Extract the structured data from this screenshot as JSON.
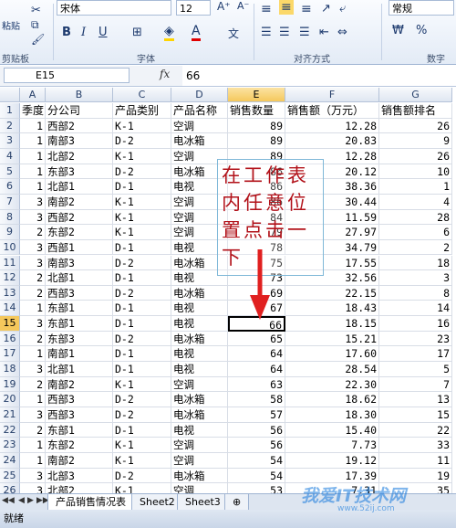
{
  "ribbon": {
    "font_name": "宋体",
    "font_size": "12",
    "number_format": "常规",
    "paste_label": "粘贴",
    "clipboard_label": "剪贴板",
    "font_group_label": "字体",
    "align_group_label": "对齐方式",
    "number_group_label": "数字",
    "bold": "B",
    "italic": "I",
    "underline": "U",
    "font_char": "A",
    "wen": "文",
    "currency": "₩",
    "percent": "%"
  },
  "formula_bar": {
    "cell_ref": "E15",
    "fx": "fx",
    "value": "66"
  },
  "columns": [
    "A",
    "B",
    "C",
    "D",
    "E",
    "F",
    "G"
  ],
  "selected_column": "E",
  "header_row": [
    "季度",
    "分公司",
    "产品类别",
    "产品名称",
    "销售数量",
    "销售额（万元）",
    "销售额排名"
  ],
  "rows": [
    {
      "n": "2",
      "q": "1",
      "b": "西部2",
      "c": "K-1",
      "d": "空调",
      "e": "89",
      "f": "12.28",
      "g": "26"
    },
    {
      "n": "3",
      "q": "1",
      "b": "南部3",
      "c": "D-2",
      "d": "电冰箱",
      "e": "89",
      "f": "20.83",
      "g": "9"
    },
    {
      "n": "4",
      "q": "1",
      "b": "北部2",
      "c": "K-1",
      "d": "空调",
      "e": "89",
      "f": "12.28",
      "g": "26"
    },
    {
      "n": "5",
      "q": "1",
      "b": "东部3",
      "c": "D-2",
      "d": "电冰箱",
      "e": "86",
      "f": "20.12",
      "g": "10"
    },
    {
      "n": "6",
      "q": "1",
      "b": "北部1",
      "c": "D-1",
      "d": "电视",
      "e": "86",
      "f": "38.36",
      "g": "1"
    },
    {
      "n": "7",
      "q": "3",
      "b": "南部2",
      "c": "K-1",
      "d": "空调",
      "e": "86",
      "f": "30.44",
      "g": "4"
    },
    {
      "n": "8",
      "q": "3",
      "b": "西部2",
      "c": "K-1",
      "d": "空调",
      "e": "84",
      "f": "11.59",
      "g": "28"
    },
    {
      "n": "9",
      "q": "2",
      "b": "东部2",
      "c": "K-1",
      "d": "空调",
      "e": "79",
      "f": "27.97",
      "g": "6"
    },
    {
      "n": "10",
      "q": "3",
      "b": "西部1",
      "c": "D-1",
      "d": "电视",
      "e": "78",
      "f": "34.79",
      "g": "2"
    },
    {
      "n": "11",
      "q": "3",
      "b": "南部3",
      "c": "D-2",
      "d": "电冰箱",
      "e": "75",
      "f": "17.55",
      "g": "18"
    },
    {
      "n": "12",
      "q": "2",
      "b": "北部1",
      "c": "D-1",
      "d": "电视",
      "e": "73",
      "f": "32.56",
      "g": "3"
    },
    {
      "n": "13",
      "q": "2",
      "b": "西部3",
      "c": "D-2",
      "d": "电冰箱",
      "e": "69",
      "f": "22.15",
      "g": "8"
    },
    {
      "n": "14",
      "q": "1",
      "b": "东部1",
      "c": "D-1",
      "d": "电视",
      "e": "67",
      "f": "18.43",
      "g": "14"
    },
    {
      "n": "15",
      "q": "3",
      "b": "东部1",
      "c": "D-1",
      "d": "电视",
      "e": "66",
      "f": "18.15",
      "g": "16"
    },
    {
      "n": "16",
      "q": "2",
      "b": "东部3",
      "c": "D-2",
      "d": "电冰箱",
      "e": "65",
      "f": "15.21",
      "g": "23"
    },
    {
      "n": "17",
      "q": "1",
      "b": "南部1",
      "c": "D-1",
      "d": "电视",
      "e": "64",
      "f": "17.60",
      "g": "17"
    },
    {
      "n": "18",
      "q": "3",
      "b": "北部1",
      "c": "D-1",
      "d": "电视",
      "e": "64",
      "f": "28.54",
      "g": "5"
    },
    {
      "n": "19",
      "q": "2",
      "b": "南部2",
      "c": "K-1",
      "d": "空调",
      "e": "63",
      "f": "22.30",
      "g": "7"
    },
    {
      "n": "20",
      "q": "1",
      "b": "西部3",
      "c": "D-2",
      "d": "电冰箱",
      "e": "58",
      "f": "18.62",
      "g": "13"
    },
    {
      "n": "21",
      "q": "3",
      "b": "西部3",
      "c": "D-2",
      "d": "电冰箱",
      "e": "57",
      "f": "18.30",
      "g": "15"
    },
    {
      "n": "22",
      "q": "2",
      "b": "东部1",
      "c": "D-1",
      "d": "电视",
      "e": "56",
      "f": "15.40",
      "g": "22"
    },
    {
      "n": "23",
      "q": "1",
      "b": "东部2",
      "c": "K-1",
      "d": "空调",
      "e": "56",
      "f": "7.73",
      "g": "33"
    },
    {
      "n": "24",
      "q": "1",
      "b": "南部2",
      "c": "K-1",
      "d": "空调",
      "e": "54",
      "f": "19.12",
      "g": "11"
    },
    {
      "n": "25",
      "q": "3",
      "b": "北部3",
      "c": "D-2",
      "d": "电冰箱",
      "e": "54",
      "f": "17.39",
      "g": "19"
    },
    {
      "n": "26",
      "q": "3",
      "b": "北部2",
      "c": "K-1",
      "d": "空调",
      "e": "53",
      "f": "7.31",
      "g": "35"
    }
  ],
  "active_row": "15",
  "annotation": {
    "text": "在工作表内任意位置点击一下"
  },
  "sheets": [
    "产品销售情况表",
    "Sheet2",
    "Sheet3"
  ],
  "active_sheet": "产品销售情况表",
  "status": "就绪",
  "watermark": "我爱IT技术网",
  "watermark_url": "www.52ij.com",
  "colors": {
    "annotation_text": "#b2121a",
    "arrow": "#e02020",
    "selected_header": "#f5c85c"
  }
}
